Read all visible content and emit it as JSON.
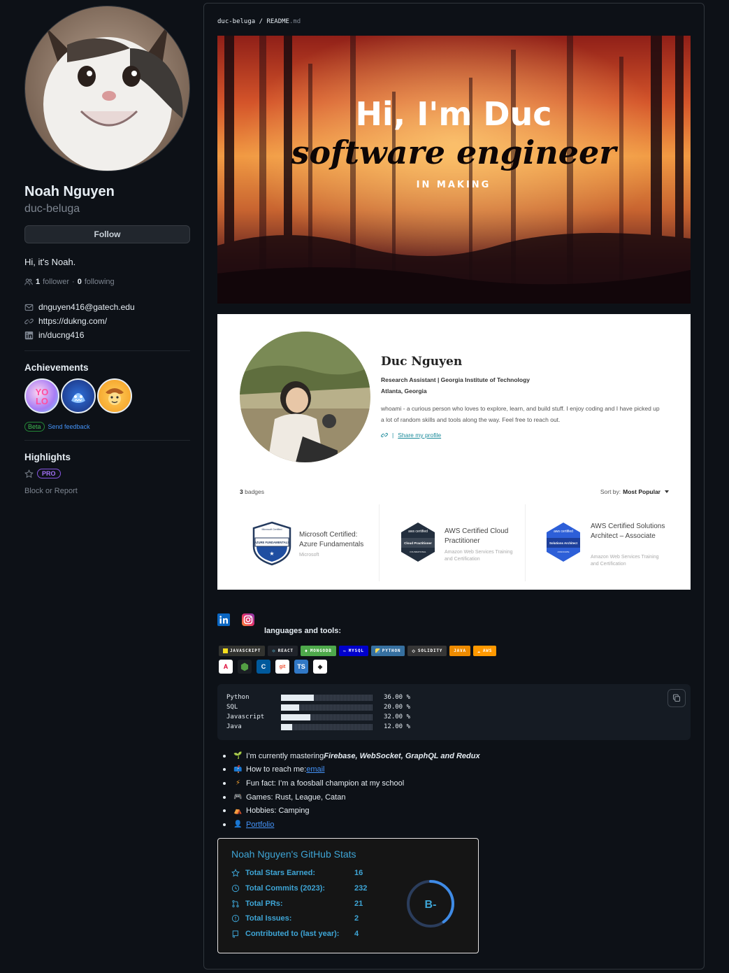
{
  "profile": {
    "name": "Noah Nguyen",
    "login": "duc-beluga",
    "follow_label": "Follow",
    "bio": "Hi, it's Noah.",
    "followers_count": "1",
    "followers_label": "follower",
    "separator": "·",
    "following_count": "0",
    "following_label": "following",
    "email": "dnguyen416@gatech.edu",
    "website": "https://dukng.com/",
    "linkedin": "in/ducng416",
    "achievements_title": "Achievements",
    "beta_label": "Beta",
    "feedback_label": "Send feedback",
    "highlights_title": "Highlights",
    "pro_label": "PRO",
    "block_label": "Block or Report"
  },
  "readme": {
    "repo": "duc-beluga",
    "file": "README",
    "ext": ".md",
    "banner": {
      "line1": "Hi, I'm Duc",
      "line2": "software engineer",
      "line3": "IN MAKING"
    },
    "card": {
      "name": "Duc Nguyen",
      "role": "Research Assistant | Georgia Institute of Technology",
      "location": "Atlanta, Georgia",
      "about": "whoami - a curious person who loves to explore, learn, and build stuff. I enjoy coding and I have picked up a lot of random skills and tools along the way. Feel free to reach out.",
      "share": "Share my profile",
      "badges_count": "3",
      "badges_label": "badges",
      "sort_prefix": "Sort by:",
      "sort_value": "Most Popular",
      "badges": [
        {
          "title": "Microsoft Certified: Azure Fundamentals",
          "issuer": "Microsoft",
          "emblem_top": "Microsoft Certified",
          "emblem_mid": "AZURE FUNDAMENTALS"
        },
        {
          "title": "AWS Certified Cloud Practitioner",
          "issuer": "Amazon Web Services Training and Certification",
          "emblem_top": "aws certified",
          "emblem_mid": "Cloud Practitioner",
          "emblem_bot": "FOUNDATIONAL"
        },
        {
          "title": "AWS Certified Solutions Architect – Associate",
          "issuer": "Amazon Web Services Training and Certification",
          "emblem_top": "aws certified",
          "emblem_mid": "Solutions Architect",
          "emblem_bot": "ASSOCIATE"
        }
      ]
    },
    "languages_title": "languages and tools:",
    "tool_badges": [
      {
        "label": "JAVASCRIPT",
        "color": "#323330",
        "icon": "js-icon"
      },
      {
        "label": "REACT",
        "color": "#20232a",
        "icon": "react-icon"
      },
      {
        "label": "MONGODB",
        "color": "#4ea94b",
        "icon": "mongodb-icon"
      },
      {
        "label": "MYSQL",
        "color": "#0000cc",
        "icon": "mysql-icon"
      },
      {
        "label": "PYTHON",
        "color": "#3670a0",
        "icon": "python-icon"
      },
      {
        "label": "SOLIDITY",
        "color": "#363636",
        "icon": "solidity-icon"
      },
      {
        "label": "JAVA",
        "color": "#ed8b00",
        "icon": "java-icon"
      },
      {
        "label": "AWS",
        "color": "#ff9900",
        "icon": "aws-icon"
      }
    ],
    "tool_tiles": [
      {
        "icon": "angular-icon",
        "text": "A",
        "color": "#dd0031"
      },
      {
        "icon": "nodejs-icon",
        "text": "⬢",
        "color": "#539e43"
      },
      {
        "icon": "c-lang-icon",
        "text": "C",
        "color": "#00599c"
      },
      {
        "icon": "git-icon",
        "text": "git",
        "color": "#f05032"
      },
      {
        "icon": "typescript-icon",
        "text": "TS",
        "color": "#3178c6"
      },
      {
        "icon": "unity-icon",
        "text": "◆",
        "color": "#222222"
      }
    ],
    "languages": [
      {
        "name": "Python",
        "percent": 36.0,
        "text": "36.00 %"
      },
      {
        "name": "SQL",
        "percent": 20.0,
        "text": "20.00 %"
      },
      {
        "name": "Javascript",
        "percent": 32.0,
        "text": "32.00 %"
      },
      {
        "name": "Java",
        "percent": 12.0,
        "text": "12.00 %"
      }
    ],
    "facts": {
      "f1_prefix": "I’m currently mastering ",
      "f1_em": "Firebase, WebSocket, GraphQL and Redux",
      "f2_prefix": "How to reach me: ",
      "f2_link": "email",
      "f3": "Fun fact: I’m a foosball champion at my school",
      "f4": "Games: Rust, League, Catan",
      "f5": "Hobbies: Camping",
      "f6_link": "Portfolio"
    },
    "stats": {
      "title": "Noah Nguyen's GitHub Stats",
      "rows": [
        {
          "label": "Total Stars Earned:",
          "value": "16",
          "icon": "star-icon"
        },
        {
          "label": "Total Commits (2023):",
          "value": "232",
          "icon": "clock-icon"
        },
        {
          "label": "Total PRs:",
          "value": "21",
          "icon": "pull-request-icon"
        },
        {
          "label": "Total Issues:",
          "value": "2",
          "icon": "issue-icon"
        },
        {
          "label": "Contributed to (last year):",
          "value": "4",
          "icon": "repo-icon"
        }
      ],
      "grade": "B-",
      "grade_progress": 0.4
    }
  }
}
